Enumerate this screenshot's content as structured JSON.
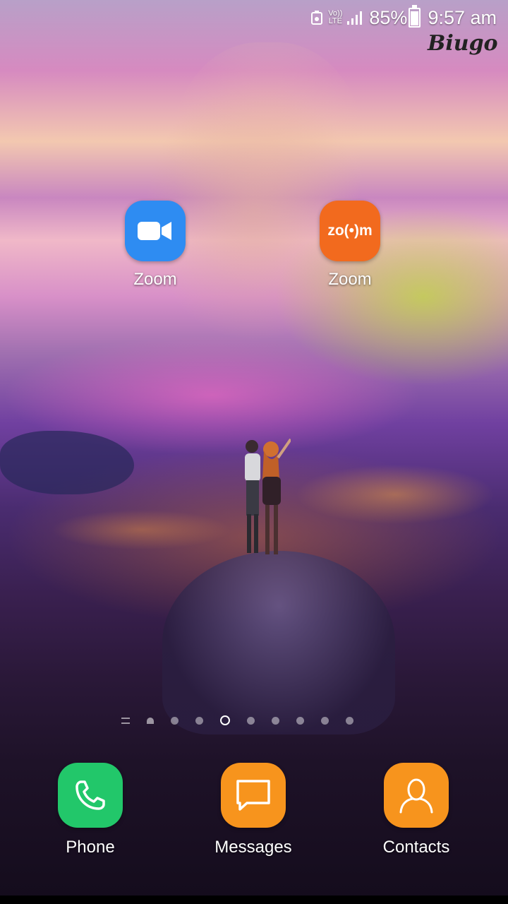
{
  "status_bar": {
    "volte_line1": "Vo))",
    "volte_line2": "LTE",
    "battery": "85%",
    "battery_level": 0.85,
    "time": "9:57 am",
    "icons": [
      "image-saver-icon",
      "volte-icon",
      "signal-icon",
      "battery-icon"
    ]
  },
  "watermark": "Biugo",
  "apps": [
    {
      "label": "Zoom",
      "icon": "zoom-camera-icon",
      "color": "#2e8cf2"
    },
    {
      "label": "Zoom",
      "icon_text": "zo(•)m",
      "color": "#f26a1e"
    }
  ],
  "pager": {
    "current_index": 3,
    "count": 9
  },
  "dock": [
    {
      "label": "Phone",
      "icon": "phone-icon",
      "color": "#22c76a"
    },
    {
      "label": "Messages",
      "icon": "message-icon",
      "color": "#f7941d"
    },
    {
      "label": "Contacts",
      "icon": "contact-icon",
      "color": "#f7941d"
    }
  ]
}
